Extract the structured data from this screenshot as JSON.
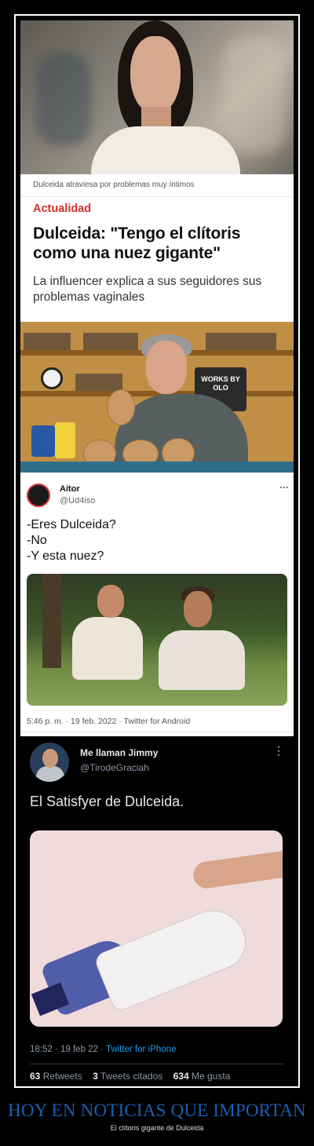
{
  "article": {
    "image_caption": "Dulceida atraviesa por problemas muy íntimos",
    "section": "Actualidad",
    "headline": "Dulceida: \"Tengo el clítoris como una nuez gigante\"",
    "subheadline": "La influencer explica a sus seguidores sus problemas vaginales"
  },
  "workshop_sign": "WORKS BY OLO",
  "tweet1": {
    "name": "Aitor",
    "handle": "@Ud4iso",
    "more_icon": "···",
    "lines": [
      "-Eres Dulceida?",
      "-No",
      "-Y esta nuez?"
    ],
    "meta": "5:46 p. m. · 19 feb. 2022 · Twitter for Android"
  },
  "tweet2": {
    "name": "Me llaman Jimmy",
    "handle": "@TirodeGraciah",
    "more_icon": "⋮",
    "text": "El Satisfyer de Dulceida.",
    "meta_time": "18:52 · 19 feb 22 · ",
    "meta_source": "Twitter for iPhone",
    "retweets_count": "63",
    "retweets_label": "Retweets",
    "quotes_count": "3",
    "quotes_label": "Tweets citados",
    "likes_count": "634",
    "likes_label": "Me gusta"
  },
  "footer": {
    "title": "HOY EN NOTICIAS QUE IMPORTAN",
    "subtitle": "El clítoris gigante de Dulceida"
  },
  "colors": {
    "section_red": "#d0312d",
    "footer_blue": "#1a5fb4",
    "twitter_link": "#1d9bf0"
  }
}
